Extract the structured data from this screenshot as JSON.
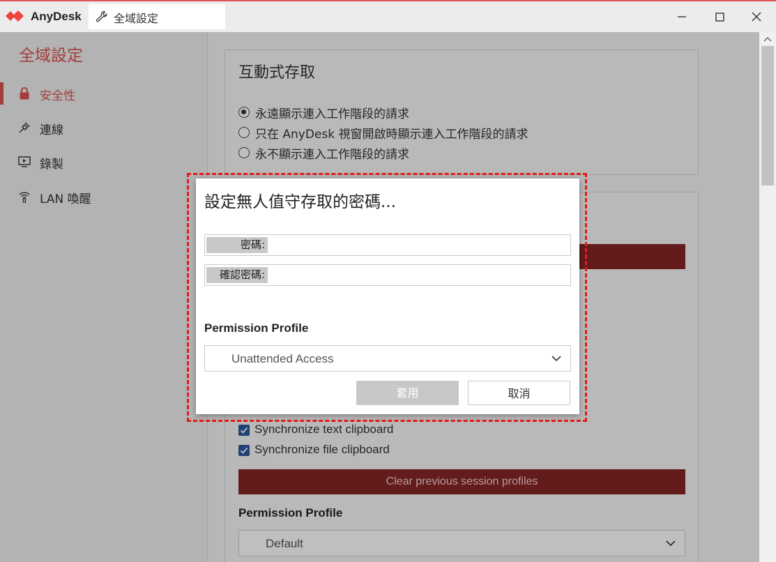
{
  "titlebar": {
    "app_name": "AnyDesk",
    "tab_label": "全域設定",
    "accent": "#ef443b"
  },
  "sidebar": {
    "title": "全域設定",
    "items": [
      {
        "label": "安全性",
        "icon": "lock-icon",
        "active": true
      },
      {
        "label": "連線",
        "icon": "plug-icon"
      },
      {
        "label": "錄製",
        "icon": "screen-play-icon"
      },
      {
        "label": "LAN 喚醒",
        "icon": "wireless-icon"
      }
    ]
  },
  "main": {
    "interactive": {
      "title": "互動式存取",
      "options": [
        {
          "label": "永遠顯示連入工作階段的請求",
          "selected": true
        },
        {
          "label": "只在 AnyDesk 視窗開啟時顯示連入工作階段的請求",
          "selected": false
        },
        {
          "label": "永不顯示連入工作階段的請求",
          "selected": false
        }
      ]
    },
    "checks": [
      {
        "label": "Synchronize text clipboard",
        "checked": true
      },
      {
        "label": "Synchronize file clipboard",
        "checked": true
      }
    ],
    "clear_button": "Clear previous session profiles",
    "permission_label": "Permission Profile",
    "permission_value": "Default"
  },
  "dialog": {
    "title": "設定無人值守存取的密碼...",
    "password_label": "密碼:",
    "confirm_label": "確認密碼:",
    "password_value": "",
    "confirm_value": "",
    "permission_label": "Permission Profile",
    "permission_value": "Unattended Access",
    "apply": "套用",
    "cancel": "取消"
  }
}
